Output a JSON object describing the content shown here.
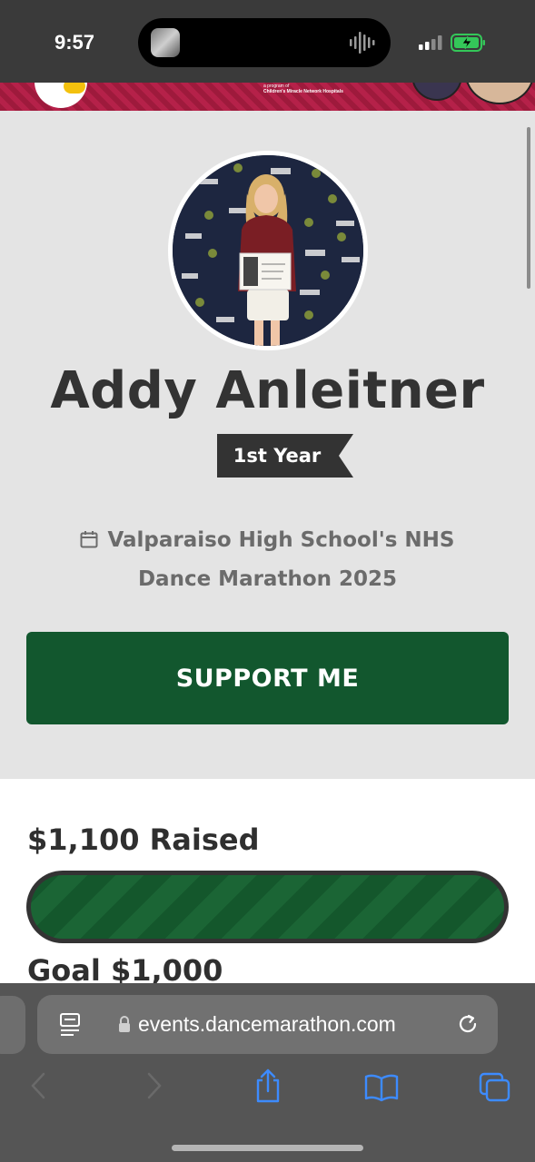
{
  "status_bar": {
    "time": "9:57"
  },
  "banner": {
    "line1": "a program of",
    "line2": "Children's Miracle Network Hospitals"
  },
  "profile": {
    "name": "Addy Anleitner",
    "year_badge": "1st Year",
    "event_line1": "Valparaiso High School's NHS",
    "event_line2": "Dance Marathon 2025"
  },
  "actions": {
    "support_label": "SUPPORT ME"
  },
  "fundraising": {
    "raised_text": "$1,100 Raised",
    "goal_text": "Goal $1,000",
    "progress_percent": 100
  },
  "browser": {
    "url": "events.dancemarathon.com"
  },
  "colors": {
    "accent_green": "#12572e",
    "banner_red": "#b52149",
    "badge": "#333333"
  },
  "icons": [
    "calendar-icon",
    "reader-icon",
    "lock-icon",
    "reload-icon",
    "back-icon",
    "forward-icon",
    "share-icon",
    "bookmarks-icon",
    "tabs-icon"
  ]
}
